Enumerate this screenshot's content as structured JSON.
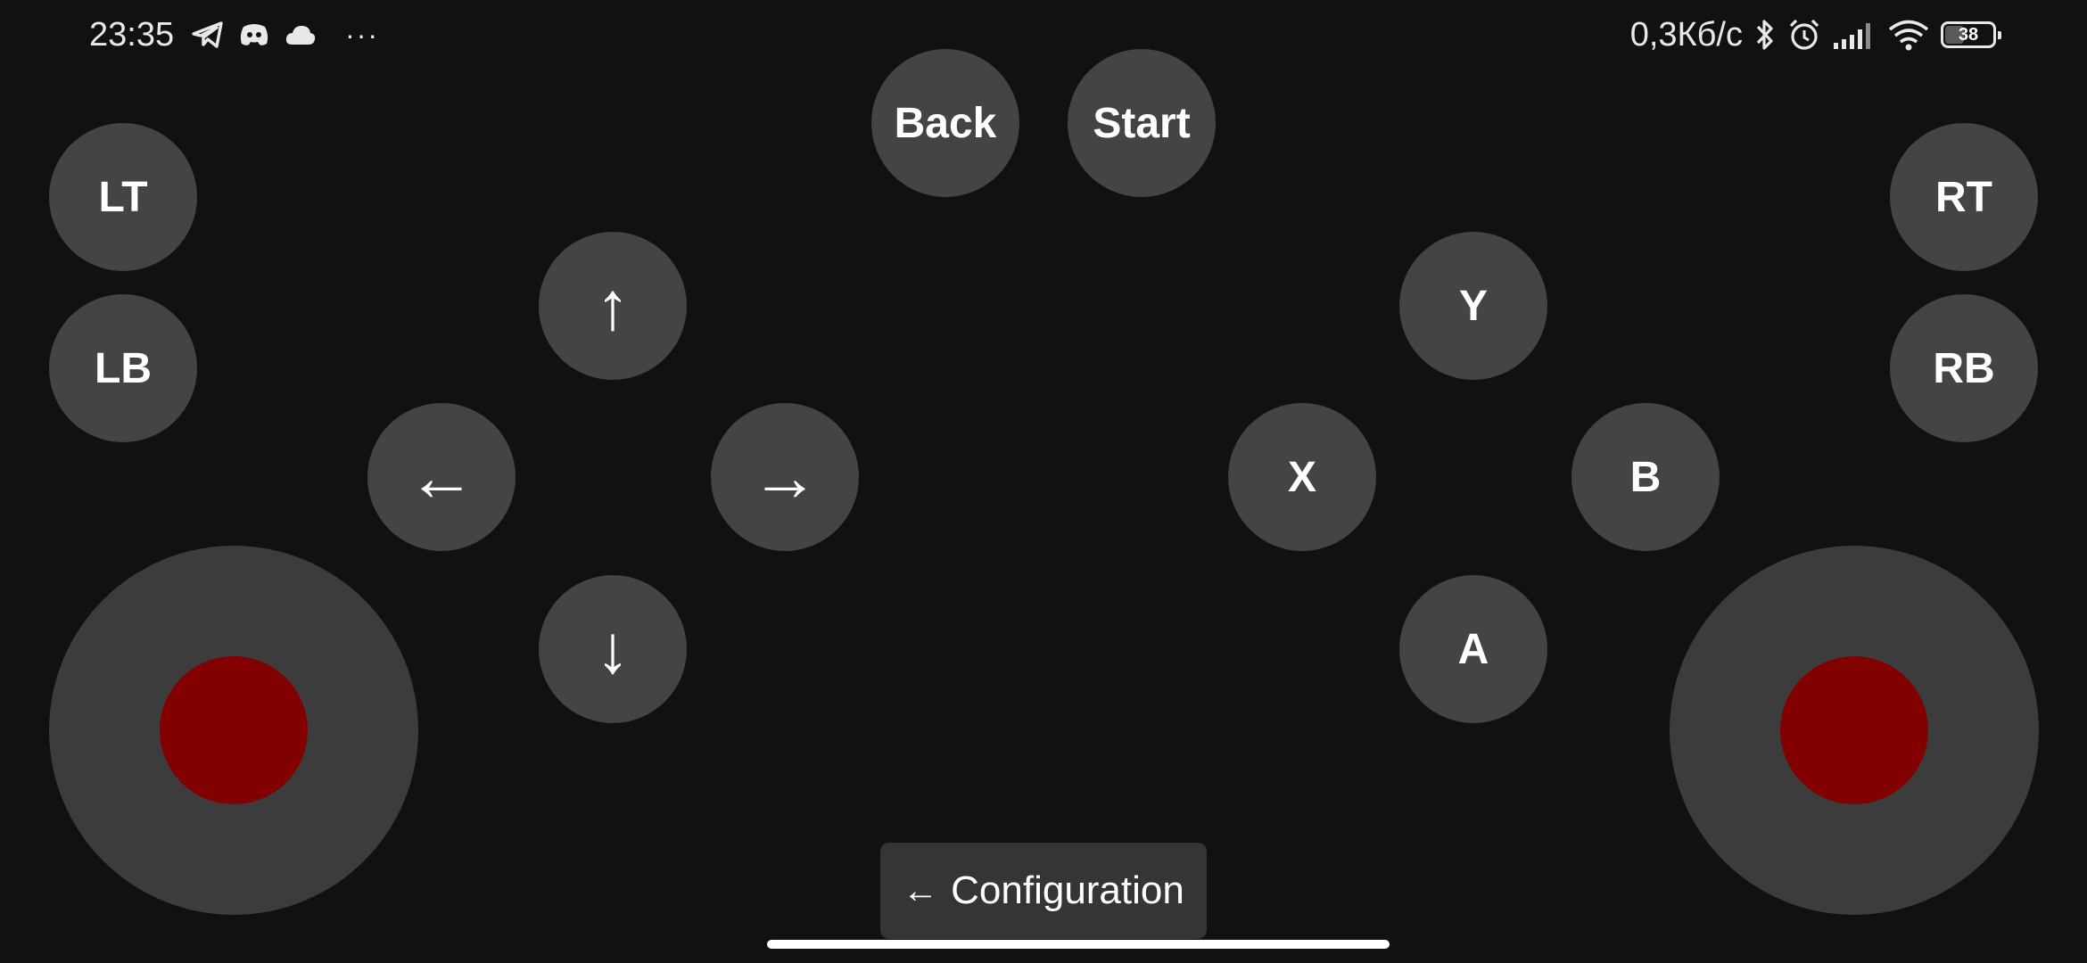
{
  "status_bar": {
    "time": "23:35",
    "more_indicator": "···",
    "net_speed": "0,3Кб/с",
    "battery": 38,
    "icons_left": [
      "telegram-icon",
      "discord-icon",
      "cloud-icon"
    ],
    "icons_right": [
      "bluetooth-icon",
      "alarm-icon",
      "signal-icon",
      "wifi-icon",
      "battery-icon"
    ]
  },
  "buttons": {
    "back": "Back",
    "start": "Start",
    "lt": "LT",
    "lb": "LB",
    "rt": "RT",
    "rb": "RB",
    "dpad_up": "↑",
    "dpad_left": "←",
    "dpad_right": "→",
    "dpad_down": "↓",
    "y": "Y",
    "x": "X",
    "b": "B",
    "a": "A"
  },
  "config": {
    "arrow": "←",
    "label": "Configuration"
  },
  "colors": {
    "background": "#111111",
    "button": "#444444",
    "stick_base": "#3c3c3c",
    "stick_knob": "#820000",
    "config_button": "#353535"
  }
}
